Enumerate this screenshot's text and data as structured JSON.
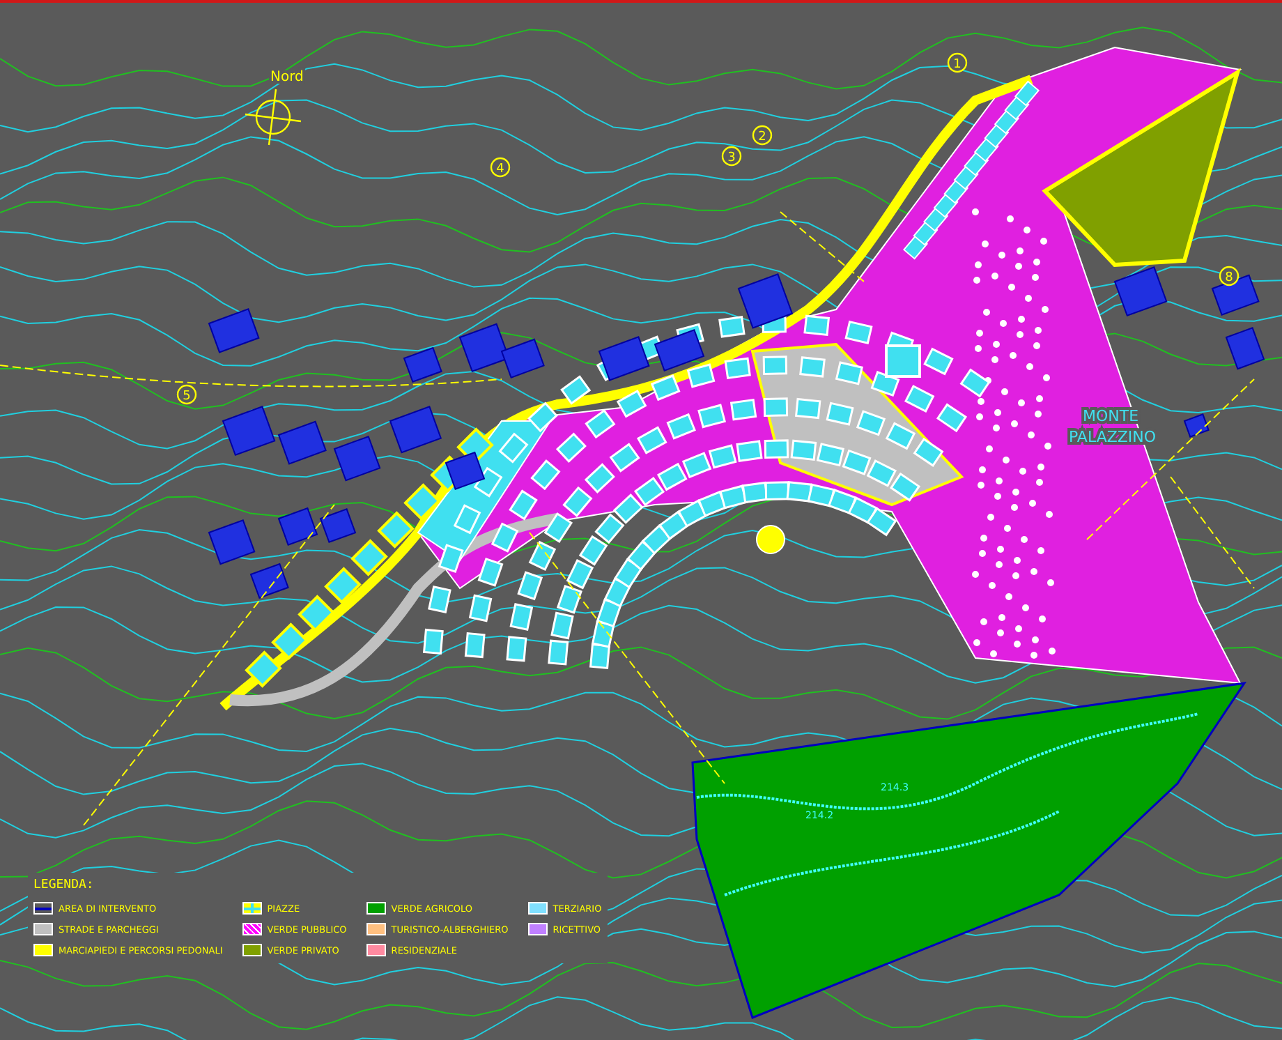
{
  "compass": {
    "label": "Nord"
  },
  "place_labels": [
    "MONTE",
    "PALAZZINO"
  ],
  "elevations": [
    "214.3",
    "214.2"
  ],
  "section_markers": [
    "1",
    "2",
    "3",
    "4",
    "5",
    "8"
  ],
  "legend": {
    "title": "LEGENDA:",
    "items": [
      {
        "label": "AREA DI INTERVENTO",
        "kind": "outline",
        "color": "#0000c0"
      },
      {
        "label": "STRADE E PARCHEGGI",
        "kind": "fill",
        "color": "#c0c0c0"
      },
      {
        "label": "MARCIAPIEDI E PERCORSI PEDONALI",
        "kind": "fill",
        "color": "#ffff00"
      },
      {
        "label": "PIAZZE",
        "kind": "cross",
        "color": "#ffff00"
      },
      {
        "label": "VERDE PUBBLICO",
        "kind": "dots",
        "color": "#ff00ff"
      },
      {
        "label": "VERDE PRIVATO",
        "kind": "fill",
        "color": "#80a000"
      },
      {
        "label": "VERDE AGRICOLO",
        "kind": "fill",
        "color": "#00a000"
      },
      {
        "label": "TURISTICO-ALBERGHIERO",
        "kind": "fill",
        "color": "#ffc080"
      },
      {
        "label": "RESIDENZIALE",
        "kind": "fill",
        "color": "#ff8aa0"
      },
      {
        "label": "TERZIARIO",
        "kind": "fill",
        "color": "#80e0ff"
      },
      {
        "label": "RICETTIVO",
        "kind": "fill",
        "color": "#c080ff"
      }
    ]
  }
}
